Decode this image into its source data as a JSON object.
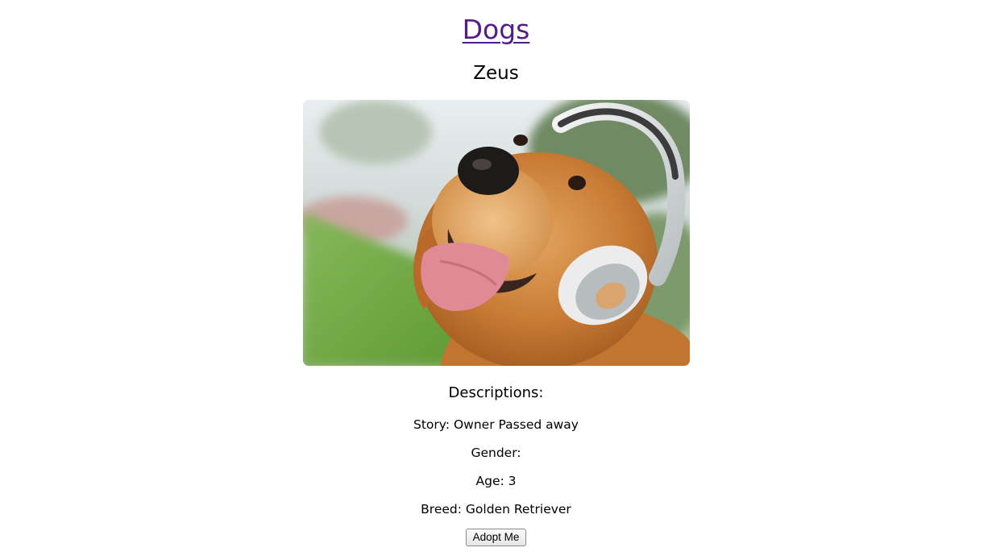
{
  "header": {
    "site_title": "Dogs"
  },
  "dog": {
    "name": "Zeus",
    "photo_subject": "golden retriever wearing white headphones"
  },
  "descriptions": {
    "heading": "Descriptions:",
    "story": "Story: Owner Passed away",
    "gender": "Gender:",
    "age": "Age: 3",
    "breed": "Breed: Golden Retriever"
  },
  "actions": {
    "adopt_label": "Adopt Me"
  },
  "colors": {
    "link_visited": "#551a8b",
    "text": "#000000",
    "background": "#ffffff"
  }
}
